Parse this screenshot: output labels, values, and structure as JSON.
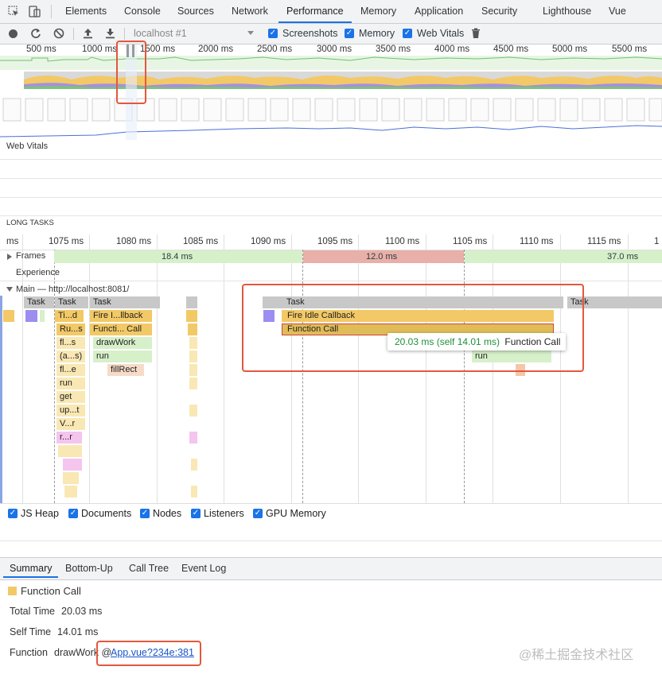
{
  "tabs": [
    "Elements",
    "Console",
    "Sources",
    "Network",
    "Performance",
    "Memory",
    "Application",
    "Security",
    "Lighthouse",
    "Vue"
  ],
  "active_tab": "Performance",
  "toolbar": {
    "profile_select": "localhost #1",
    "screenshots_label": "Screenshots",
    "memory_label": "Memory",
    "web_vitals_label": "Web Vitals"
  },
  "overview_ticks": [
    "500 ms",
    "1000 ms",
    "1500 ms",
    "2000 ms",
    "2500 ms",
    "3000 ms",
    "3500 ms",
    "4000 ms",
    "4500 ms",
    "5000 ms",
    "5500 ms"
  ],
  "sections": {
    "web_vitals": "Web Vitals",
    "long_tasks": "LONG TASKS",
    "frames": "Frames",
    "experience": "Experience",
    "main": "Main — http://localhost:8081/"
  },
  "detail_ticks": [
    "ms",
    "1075 ms",
    "1080 ms",
    "1085 ms",
    "1090 ms",
    "1095 ms",
    "1100 ms",
    "1105 ms",
    "1110 ms",
    "1115 ms",
    "1"
  ],
  "frames": [
    "18.4 ms",
    "12.0 ms",
    "37.0 ms"
  ],
  "flame": {
    "task": "Task",
    "tid": "Ti...d",
    "rus": "Ru...s",
    "fls": "fl...s",
    "as": "(a...s)",
    "fle": "fl...e",
    "run": "run",
    "get": "get",
    "upt": "up...t",
    "vr": "V...r",
    "rr": "r...r",
    "fire_short": "Fire I...llback",
    "func_short": "Functi... Call",
    "drawwork": "drawWork",
    "fillrect": "fillRect",
    "fire_idle": "Fire Idle Callback",
    "function_call": "Function Call"
  },
  "tooltip": {
    "time": "20.03 ms (self 14.01 ms)",
    "name": "Function Call"
  },
  "memory_counters": [
    {
      "label": "JS Heap",
      "color": "#7b9ff0"
    },
    {
      "label": "Documents",
      "color": "#e2888a"
    },
    {
      "label": "Nodes",
      "color": "#8ee08a"
    },
    {
      "label": "Listeners",
      "color": "#efe05a"
    },
    {
      "label": "GPU Memory",
      "color": "#d894f0"
    }
  ],
  "bottom_tabs": [
    "Summary",
    "Bottom-Up",
    "Call Tree",
    "Event Log"
  ],
  "summary": {
    "title": "Function Call",
    "total_time_label": "Total Time",
    "total_time": "20.03 ms",
    "self_time_label": "Self Time",
    "self_time": "14.01 ms",
    "function_label": "Function",
    "function_name": "drawWork @",
    "function_link": "App.vue?234e:381"
  },
  "watermark": "@稀土掘金技术社区",
  "colors": {
    "accent": "#1a73e8",
    "function_call": "#f2c966",
    "highlight": "#e4573d"
  }
}
